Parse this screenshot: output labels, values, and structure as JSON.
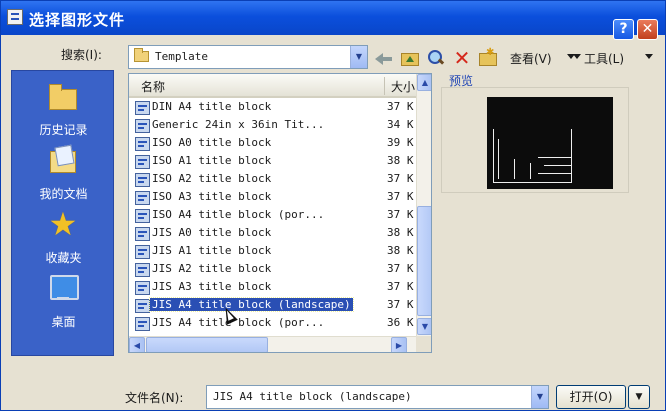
{
  "window": {
    "title": "选择图形文件"
  },
  "toolbar": {
    "lookin_label": "搜索(I):",
    "lookin_value": "Template",
    "views_label": "查看(V)",
    "tools_label": "工具(L)"
  },
  "places": [
    {
      "label": "历史记录",
      "icon": "history-folder-icon"
    },
    {
      "label": "我的文档",
      "icon": "my-documents-icon"
    },
    {
      "label": "收藏夹",
      "icon": "favorites-star-icon"
    },
    {
      "label": "桌面",
      "icon": "desktop-icon"
    }
  ],
  "filelist": {
    "columns": {
      "name": "名称",
      "size": "大小"
    },
    "rows": [
      {
        "name": "DIN A4 title block",
        "size": "37 K"
      },
      {
        "name": "Generic 24in x 36in Tit...",
        "size": "34 K"
      },
      {
        "name": "ISO A0 title block",
        "size": "39 K"
      },
      {
        "name": "ISO A1 title block",
        "size": "38 K"
      },
      {
        "name": "ISO A2 title block",
        "size": "37 K"
      },
      {
        "name": "ISO A3 title block",
        "size": "37 K"
      },
      {
        "name": "ISO A4 title block (por...",
        "size": "37 K"
      },
      {
        "name": "JIS A0 title block",
        "size": "38 K"
      },
      {
        "name": "JIS A1 title block",
        "size": "38 K"
      },
      {
        "name": "JIS A2 title block",
        "size": "37 K"
      },
      {
        "name": "JIS A3 title block",
        "size": "37 K"
      },
      {
        "name": "JIS A4 title block (landscape)",
        "size": "37 K",
        "selected": true
      },
      {
        "name": "JIS A4 title block (por...",
        "size": "36 K"
      }
    ]
  },
  "preview": {
    "label": "预览"
  },
  "bottom": {
    "filename_label": "文件名(N):",
    "filename_value": "JIS A4 title block (landscape)",
    "open_label": "打开(O)"
  },
  "colors": {
    "titlebar": "#0b4fdc",
    "places_bar": "#3a62c8",
    "selection": "#2a4fb4"
  }
}
